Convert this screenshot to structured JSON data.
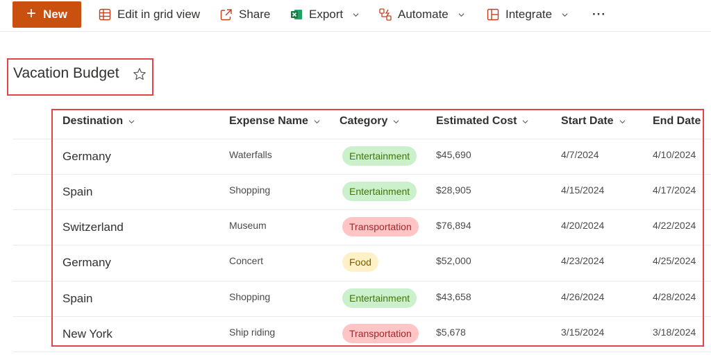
{
  "toolbar": {
    "new_label": "New",
    "edit_grid_label": "Edit in grid view",
    "share_label": "Share",
    "export_label": "Export",
    "automate_label": "Automate",
    "integrate_label": "Integrate",
    "more_label": "···"
  },
  "list": {
    "title": "Vacation Budget"
  },
  "columns": [
    "Destination",
    "Expense Name",
    "Category",
    "Estimated Cost",
    "Start Date",
    "End Date"
  ],
  "category_colors": {
    "Entertainment": {
      "bg": "#caf0cc",
      "fg": "#437406"
    },
    "Transportation": {
      "bg": "#ffc5c5",
      "fg": "#a4262c"
    },
    "Food": {
      "bg": "#fff1c7",
      "fg": "#7a5a00"
    }
  },
  "rows": [
    {
      "destination": "Germany",
      "expense": "Waterfalls",
      "category": "Entertainment",
      "cost": "$45,690",
      "start": "4/7/2024",
      "end": "4/10/2024"
    },
    {
      "destination": "Spain",
      "expense": "Shopping",
      "category": "Entertainment",
      "cost": "$28,905",
      "start": "4/15/2024",
      "end": "4/17/2024"
    },
    {
      "destination": "Switzerland",
      "expense": "Museum",
      "category": "Transportation",
      "cost": "$76,894",
      "start": "4/20/2024",
      "end": "4/22/2024"
    },
    {
      "destination": "Germany",
      "expense": "Concert",
      "category": "Food",
      "cost": "$52,000",
      "start": "4/23/2024",
      "end": "4/25/2024"
    },
    {
      "destination": "Spain",
      "expense": "Shopping",
      "category": "Entertainment",
      "cost": "$43,658",
      "start": "4/26/2024",
      "end": "4/28/2024"
    },
    {
      "destination": "New York",
      "expense": "Ship riding",
      "category": "Transportation",
      "cost": "$5,678",
      "start": "3/15/2024",
      "end": "3/18/2024"
    }
  ]
}
